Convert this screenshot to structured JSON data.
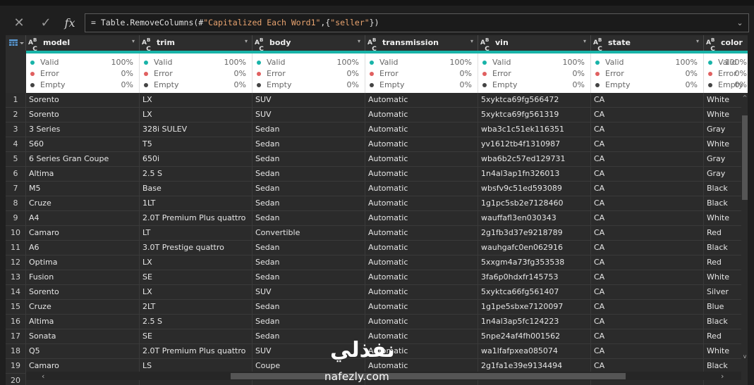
{
  "formula_bar": {
    "cancel_icon": "close-icon",
    "commit_icon": "check-icon",
    "fx_label": "fx",
    "formula_prefix": "= Table.RemoveColumns(#",
    "formula_str1": "\"Capitalized Each Word1\"",
    "formula_mid": ",{",
    "formula_str2": "\"seller\"",
    "formula_suffix": "})"
  },
  "columns": [
    {
      "name": "model",
      "type": "ABC"
    },
    {
      "name": "trim",
      "type": "ABC"
    },
    {
      "name": "body",
      "type": "ABC"
    },
    {
      "name": "transmission",
      "type": "ABC"
    },
    {
      "name": "vin",
      "type": "ABC"
    },
    {
      "name": "state",
      "type": "ABC"
    },
    {
      "name": "color",
      "type": "ABC"
    }
  ],
  "quality": {
    "valid_label": "Valid",
    "error_label": "Error",
    "empty_label": "Empty",
    "valid_pct": "100%",
    "error_pct": "0%",
    "empty_pct": "0%",
    "colors": {
      "valid": "#18b3a8",
      "error": "#e06060",
      "empty": "#444444"
    }
  },
  "rows": [
    [
      "1",
      "Sorento",
      "LX",
      "SUV",
      "Automatic",
      "5xyktca69fg566472",
      "CA",
      "White"
    ],
    [
      "2",
      "Sorento",
      "LX",
      "SUV",
      "Automatic",
      "5xyktca69fg561319",
      "CA",
      "White"
    ],
    [
      "3",
      "3 Series",
      "328i SULEV",
      "Sedan",
      "Automatic",
      "wba3c1c51ek116351",
      "CA",
      "Gray"
    ],
    [
      "4",
      "S60",
      "T5",
      "Sedan",
      "Automatic",
      "yv1612tb4f1310987",
      "CA",
      "White"
    ],
    [
      "5",
      "6 Series Gran Coupe",
      "650i",
      "Sedan",
      "Automatic",
      "wba6b2c57ed129731",
      "CA",
      "Gray"
    ],
    [
      "6",
      "Altima",
      "2.5 S",
      "Sedan",
      "Automatic",
      "1n4al3ap1fn326013",
      "CA",
      "Gray"
    ],
    [
      "7",
      "M5",
      "Base",
      "Sedan",
      "Automatic",
      "wbsfv9c51ed593089",
      "CA",
      "Black"
    ],
    [
      "8",
      "Cruze",
      "1LT",
      "Sedan",
      "Automatic",
      "1g1pc5sb2e7128460",
      "CA",
      "Black"
    ],
    [
      "9",
      "A4",
      "2.0T Premium Plus quattro",
      "Sedan",
      "Automatic",
      "wauffafl3en030343",
      "CA",
      "White"
    ],
    [
      "10",
      "Camaro",
      "LT",
      "Convertible",
      "Automatic",
      "2g1fb3d37e9218789",
      "CA",
      "Red"
    ],
    [
      "11",
      "A6",
      "3.0T Prestige quattro",
      "Sedan",
      "Automatic",
      "wauhgafc0en062916",
      "CA",
      "Black"
    ],
    [
      "12",
      "Optima",
      "LX",
      "Sedan",
      "Automatic",
      "5xxgm4a73fg353538",
      "CA",
      "Red"
    ],
    [
      "13",
      "Fusion",
      "SE",
      "Sedan",
      "Automatic",
      "3fa6p0hdxfr145753",
      "CA",
      "White"
    ],
    [
      "14",
      "Sorento",
      "LX",
      "SUV",
      "Automatic",
      "5xyktca66fg561407",
      "CA",
      "Silver"
    ],
    [
      "15",
      "Cruze",
      "2LT",
      "Sedan",
      "Automatic",
      "1g1pe5sbxe7120097",
      "CA",
      "Blue"
    ],
    [
      "16",
      "Altima",
      "2.5 S",
      "Sedan",
      "Automatic",
      "1n4al3ap5fc124223",
      "CA",
      "Black"
    ],
    [
      "17",
      "Sonata",
      "SE",
      "Sedan",
      "Automatic",
      "5npe24af4fh001562",
      "CA",
      "Red"
    ],
    [
      "18",
      "Q5",
      "2.0T Premium Plus quattro",
      "SUV",
      "Automatic",
      "wa1lfafpxea085074",
      "CA",
      "White"
    ],
    [
      "19",
      "Camaro",
      "LS",
      "Coupe",
      "Automatic",
      "2g1fa1e39e9134494",
      "CA",
      "Black"
    ],
    [
      "20",
      "",
      "",
      "",
      "",
      "",
      "",
      ""
    ]
  ],
  "watermark": {
    "arabic": "نفذلي",
    "latin": "nafezly.com"
  }
}
